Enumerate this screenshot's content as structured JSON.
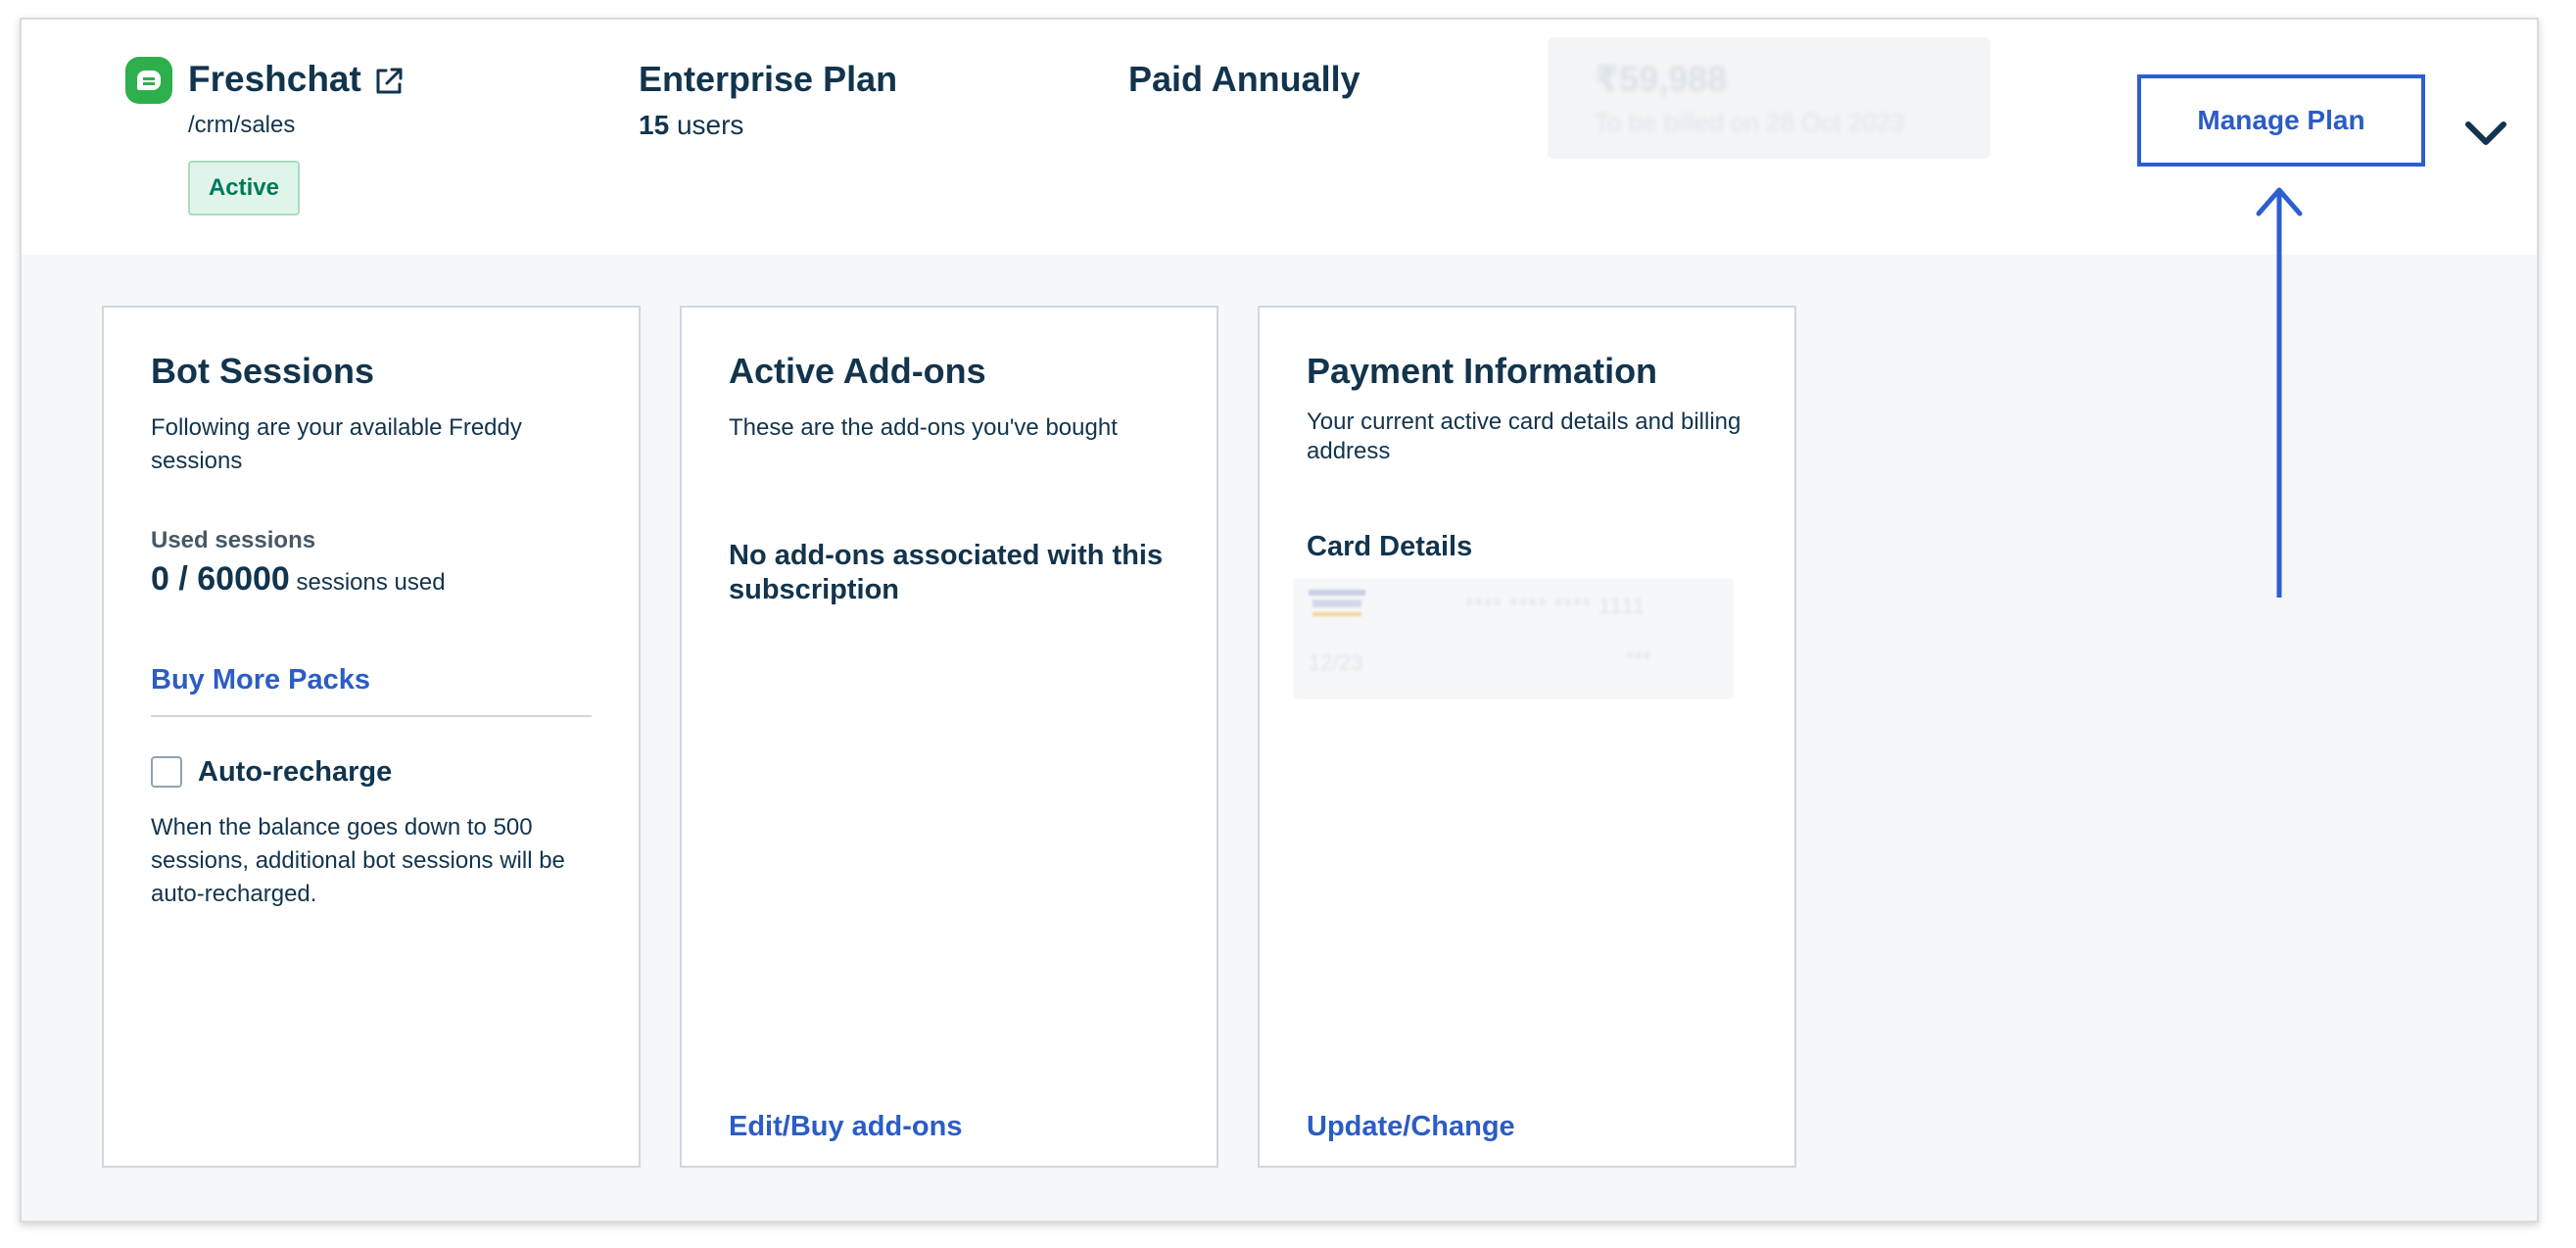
{
  "header": {
    "product_name": "Freshchat",
    "product_path": "/crm/sales",
    "status": "Active",
    "plan_name": "Enterprise Plan",
    "users_count": "15",
    "users_label": "users",
    "billing_cycle": "Paid Annually",
    "price_amount": "₹59,988",
    "price_note": "To be billed on 28 Oct 2023",
    "manage_plan_label": "Manage Plan",
    "icons": {
      "logo": "freshchat-logo",
      "external_link": "external-link-icon",
      "expand": "chevron-down-icon"
    }
  },
  "bot_sessions": {
    "title": "Bot Sessions",
    "subtitle": "Following are your available Freddy sessions",
    "used_label": "Used sessions",
    "used_value": "0 / 60000",
    "used_suffix": "sessions used",
    "buy_more_label": "Buy More Packs",
    "auto_recharge_label": "Auto-recharge",
    "auto_recharge_checked": false,
    "auto_recharge_desc": "When the balance goes down to 500 sessions, additional bot sessions will be auto-recharged."
  },
  "addons": {
    "title": "Active Add-ons",
    "subtitle": "These are the add-ons you've bought",
    "empty_message": "No add-ons associated with this subscription",
    "action_label": "Edit/Buy add-ons"
  },
  "payment": {
    "title": "Payment Information",
    "subtitle": "Your current active card details and billing address",
    "card_details_label": "Card Details",
    "card_number": "**** **** **** 1111",
    "card_expiry": "12/23",
    "card_cvv": "***",
    "action_label": "Update/Change"
  },
  "colors": {
    "brand_green": "#2db04b",
    "link_blue": "#2c5cc5",
    "text_dark": "#12344d",
    "status_green": "#00795b",
    "annotation_blue": "#2b5fcf"
  }
}
